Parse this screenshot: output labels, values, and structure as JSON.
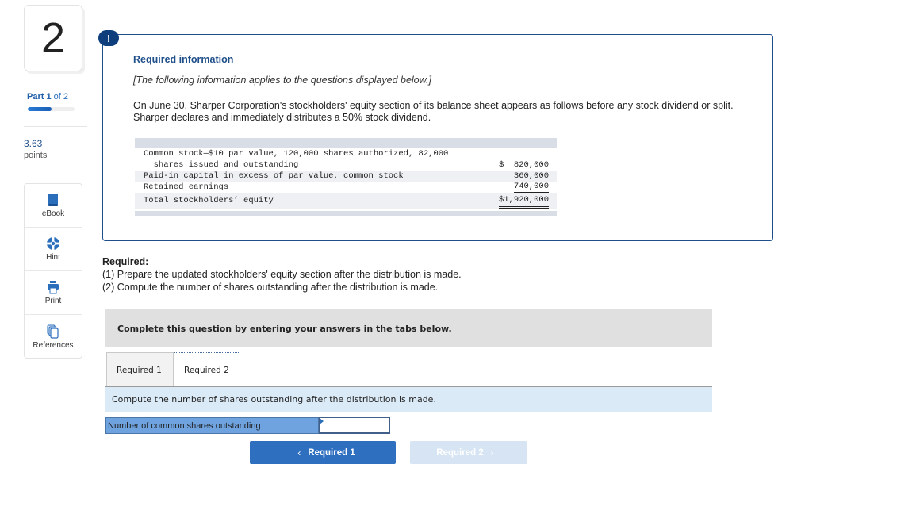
{
  "question": {
    "number": "2",
    "part": {
      "prefix": "Part",
      "current": "1",
      "of_label": "of 2",
      "progress_fraction": 0.5
    },
    "points_value": "3.63",
    "points_label": "points"
  },
  "tools": [
    {
      "label": "eBook",
      "icon": "book-icon"
    },
    {
      "label": "Hint",
      "icon": "lifebuoy-icon"
    },
    {
      "label": "Print",
      "icon": "printer-icon"
    },
    {
      "label": "References",
      "icon": "documents-icon"
    }
  ],
  "info": {
    "badge": "!",
    "title": "Required information",
    "subtitle": "[The following information applies to the questions displayed below.]",
    "body": "On June 30, Sharper Corporation's stockholders' equity section of its balance sheet appears as follows before any stock dividend or split. Sharper declares and immediately distributes a 50% stock dividend."
  },
  "equity": {
    "rows": [
      {
        "label": "Common stock—$10 par value, 120,000 shares authorized, 82,000",
        "amount": ""
      },
      {
        "label": "  shares issued and outstanding",
        "amount": "$  820,000"
      },
      {
        "label": "Paid-in capital in excess of par value, common stock",
        "amount": "360,000"
      },
      {
        "label": "Retained earnings",
        "amount": "740,000"
      },
      {
        "label": "Total stockholders’ equity",
        "amount": "$1,920,000"
      }
    ]
  },
  "required": {
    "title": "Required:",
    "items": [
      "(1) Prepare the updated stockholders' equity section after the distribution is made.",
      "(2) Compute the number of shares outstanding after the distribution is made."
    ]
  },
  "instructions": "Complete this question by entering your answers in the tabs below.",
  "tabs": [
    {
      "label": "Required 1",
      "active": false
    },
    {
      "label": "Required 2",
      "active": true
    }
  ],
  "prompt": "Compute the number of shares outstanding after the distribution is made.",
  "answer": {
    "label": "Number of common shares outstanding",
    "value": "",
    "placeholder": ""
  },
  "nav": {
    "prev_label": "Required 1",
    "next_label": "Required 2"
  },
  "colors": {
    "brand_dark": "#1f4f8a",
    "primary_button": "#2e6fc0",
    "disabled_button": "#d6e4f3",
    "label_cell": "#6fa3e0",
    "prompt_band": "#daeaf7"
  }
}
